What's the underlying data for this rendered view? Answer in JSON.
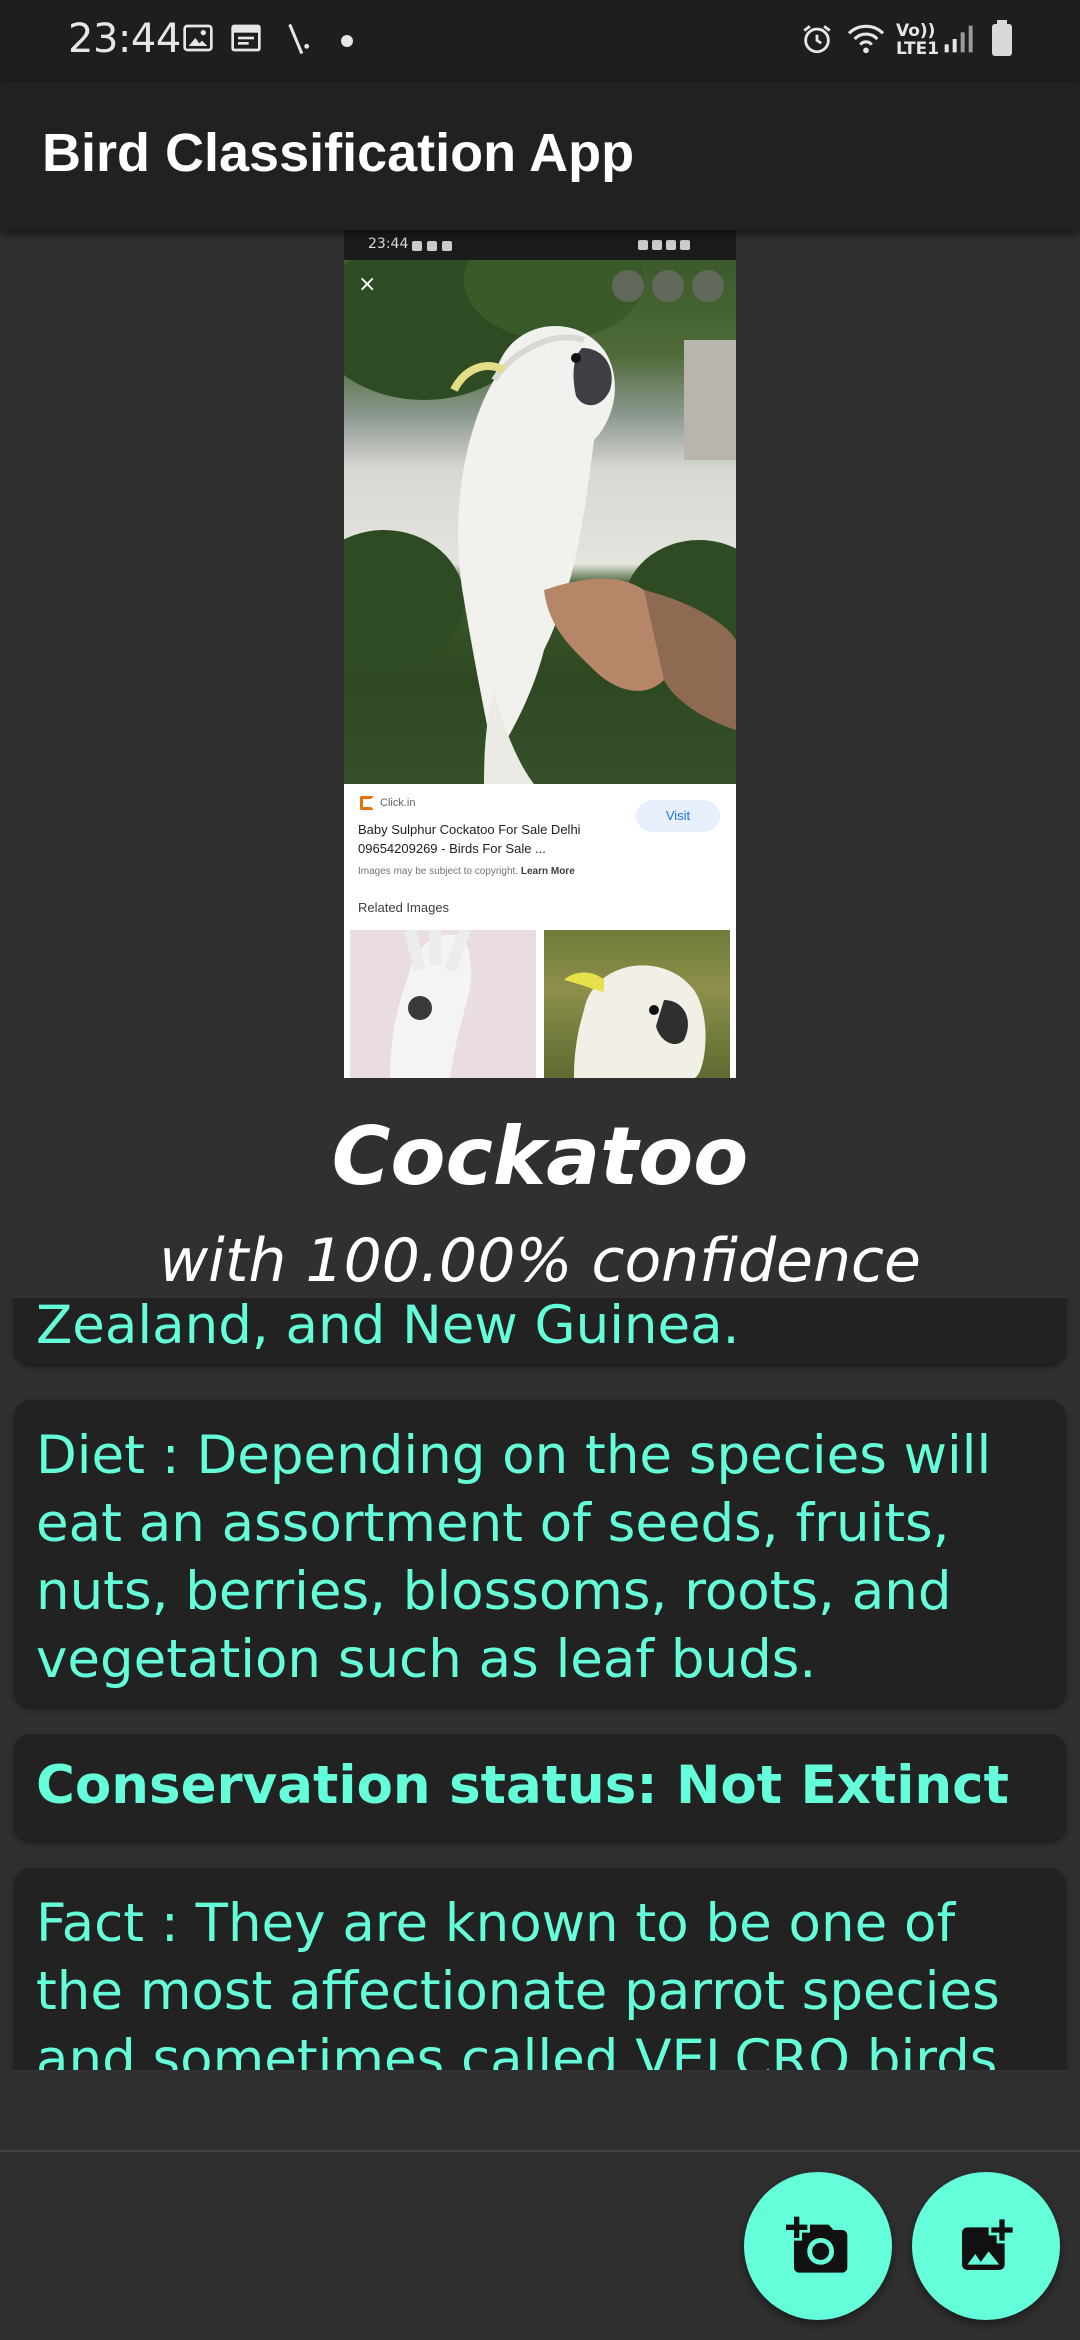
{
  "status_bar": {
    "time": "23:44",
    "lte_label_top": "Vo))",
    "lte_label_bottom": "LTE1",
    "icons": [
      "gallery-icon",
      "calendar-icon",
      "slash-icon",
      "dot-icon",
      "alarm-icon",
      "wifi-icon",
      "signal-icon",
      "battery-icon"
    ]
  },
  "app_bar": {
    "title": "Bird Classification App"
  },
  "embedded_screenshot": {
    "status_time": "23:44",
    "source": "Click.in",
    "title": "Baby Sulphur Cockatoo For Sale Delhi 09654209269 - Birds For Sale ...",
    "visit_label": "Visit",
    "copyright_text": "Images may be subject to copyright.",
    "learn_more": "Learn More",
    "related_label": "Related Images",
    "close_symbol": "×"
  },
  "result": {
    "name": "Cockatoo",
    "confidence": "with 100.00% confidence"
  },
  "info_cards": {
    "range_tail": "Zealand, and New Guinea.",
    "diet": "Diet : Depending on the species will eat an assortment of seeds, fruits, nuts, berries, blossoms, roots, and vegetation such as leaf buds.",
    "conservation": "Conservation status: Not Extinct",
    "fact": "Fact : They are known to be one of the most affectionate parrot species and sometimes called VELCRO birds."
  },
  "fabs": [
    "add-photo-camera-icon",
    "add-photo-gallery-icon"
  ],
  "colors": {
    "background": "#303030",
    "app_bar": "#212121",
    "accent": "#64ffda",
    "card": "#222222"
  }
}
